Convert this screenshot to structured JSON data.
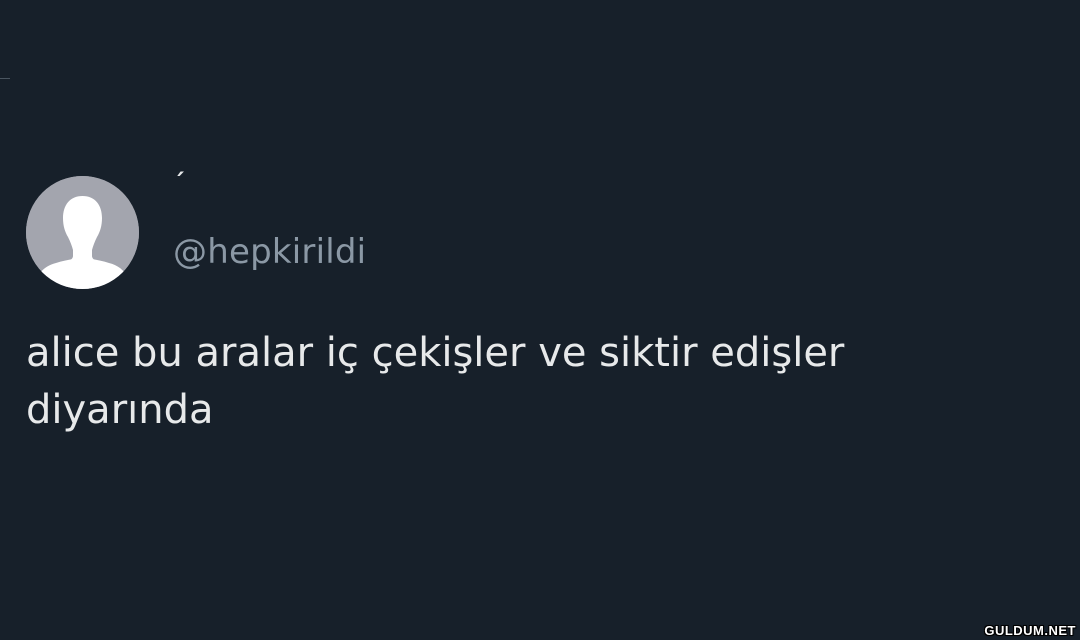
{
  "tweet": {
    "display_name": "´",
    "handle": "@hepkirildi",
    "text": "alice bu aralar iç çekişler ve siktir edişler\ndiyarında",
    "avatar_icon": "default-profile-silhouette-icon"
  },
  "watermark": {
    "text": "GULDUM.NET"
  },
  "colors": {
    "background": "#17202a",
    "text_primary": "#e7e9ea",
    "text_secondary": "#8b98a5",
    "avatar_bg": "#a3a5ae"
  }
}
